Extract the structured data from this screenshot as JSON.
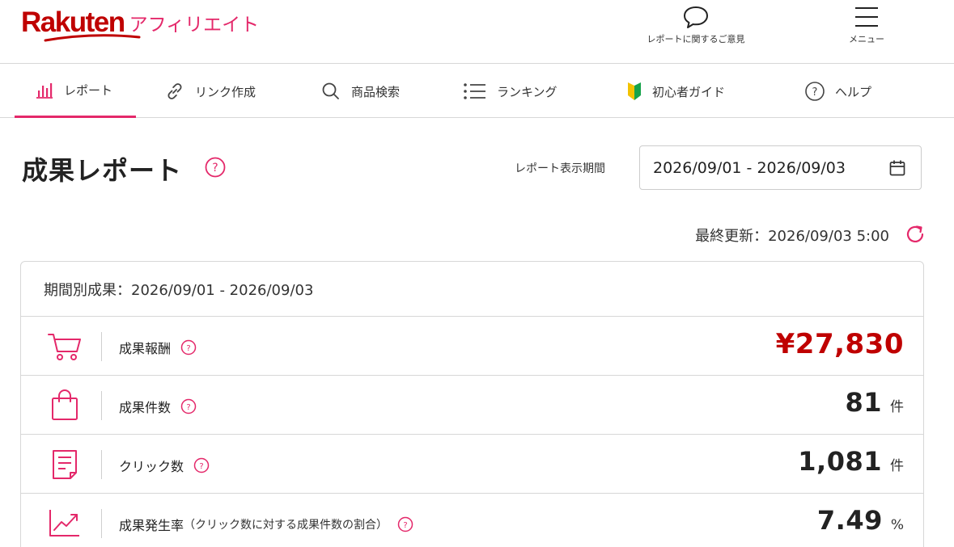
{
  "header": {
    "logo_main": "Rakuten",
    "logo_sub": "アフィリエイト",
    "feedback_label": "レポートに関するご意見",
    "menu_label": "メニュー"
  },
  "nav": {
    "items": [
      {
        "label": "レポート",
        "icon": "bar-chart-icon",
        "active": true
      },
      {
        "label": "リンク作成",
        "icon": "link-icon"
      },
      {
        "label": "商品検索",
        "icon": "search-icon"
      },
      {
        "label": "ランキング",
        "icon": "list-icon"
      },
      {
        "label": "初心者ガイド",
        "icon": "beginner-mark-icon"
      },
      {
        "label": "ヘルプ",
        "icon": "help-circle-icon"
      }
    ]
  },
  "page": {
    "title": "成果レポート",
    "period_label": "レポート表示期間",
    "period_value": "2026/09/01 - 2026/09/03",
    "last_updated": "最終更新：2026/09/03 5:00"
  },
  "card": {
    "header": "期間別成果：2026/09/01 - 2026/09/03",
    "rows": [
      {
        "icon": "cart-icon",
        "label": "成果報酬",
        "sub": "",
        "value": "¥27,830",
        "unit": ""
      },
      {
        "icon": "bag-icon",
        "label": "成果件数",
        "sub": "",
        "value": "81",
        "unit": "件"
      },
      {
        "icon": "receipt-icon",
        "label": "クリック数",
        "sub": "",
        "value": "1,081",
        "unit": "件"
      },
      {
        "icon": "trend-up-icon",
        "label": "成果発生率",
        "sub": "（クリック数に対する成果件数の割合）",
        "value": "7.49",
        "unit": "%"
      }
    ]
  },
  "colors": {
    "brand": "#bf0000",
    "accent": "#e4286a",
    "border": "#d7d7d7"
  }
}
